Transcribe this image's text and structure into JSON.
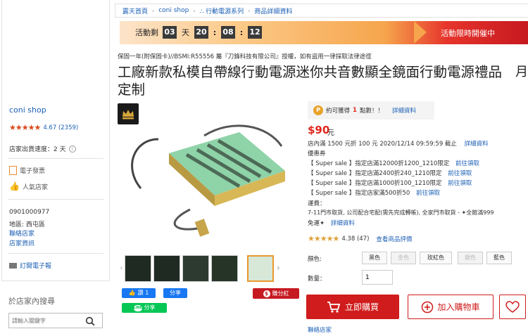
{
  "breadcrumb": [
    "露天首頁",
    "coni shop",
    "∴ 行動電源系列",
    "商品詳細資料"
  ],
  "banner": {
    "label_left": "活動剩",
    "days": "03",
    "day_unit": "天",
    "hours": "20",
    "minutes": "08",
    "seconds": "12",
    "label_right": "活動限時開催中"
  },
  "sidebar": {
    "shop_name": "coni shop",
    "rating": "4.67 (2359)",
    "ship_speed": "店家出貨速度：2 天",
    "invoice": "電子發票",
    "popular": "人氣店家",
    "phone": "0901000977",
    "region": "地區: 西屯區",
    "contact": "聯絡店家",
    "shop_info": "店家資訊",
    "subscribe": "訂閱電子報",
    "search_title": "於店家內搜尋",
    "search_placeholder": "請輸入關鍵字"
  },
  "product": {
    "warning": "保固一年(附保固卡)//BSMI:R55556 屬『刀鋒科技有限公司』授權，如有盜用一律採取法律途徑",
    "title": "工廠新款私模自帶線行動電源迷你共音數顯全鏡面行動電源禮品定制",
    "side_char": "月"
  },
  "info": {
    "points_text": "約可獲得",
    "points_value": "1",
    "points_unit": "點數！！",
    "points_link": "詳細資料",
    "price": "$90",
    "price_unit": "元",
    "discount": "店內滿 1500 元折 100 元 2020/12/14 09:59:59 截止",
    "discount_link": "詳細資料",
    "coupon_title": "優惠券",
    "coupons": [
      {
        "text": "【 Super sale 】指定店滿12000折1200_1210限定",
        "link": "前往領取"
      },
      {
        "text": "【 Super sale 】指定店滿2400折240_1210限定",
        "link": "前往領取"
      },
      {
        "text": "【 Super sale 】指定店滿1000折100_1210限定",
        "link": "前往領取"
      },
      {
        "text": "【 Super sale 】指定店家滿500折50",
        "link": "前往領取"
      }
    ],
    "shipping_title": "運費：",
    "shipping_text": "7-11門市取貨, 公司配合宅配(需先完成轉帳), 全家門市取貨 - ✦全館滿999",
    "shipping_text2": "免運✦",
    "shipping_link": "詳細資料",
    "rating": "4.38 (47)",
    "rating_link": "查看商品評價",
    "color_label": "顏色:",
    "colors": [
      "黑色",
      "金色",
      "玫紅色",
      "銀色",
      "藍色"
    ],
    "qty_label": "數量：",
    "qty_value": "1",
    "buy_label": "立即購買",
    "cart_label": "加入購物車",
    "contact_link": "聯絡店家"
  },
  "share": {
    "like_label": "讚 1",
    "share_label": "分享",
    "line_share": "分享",
    "earn_label": "賺分紅"
  },
  "colors": {
    "accent_red": "#d01c1c",
    "link_blue": "#1b5fb5",
    "star_orange": "#d9481a"
  }
}
